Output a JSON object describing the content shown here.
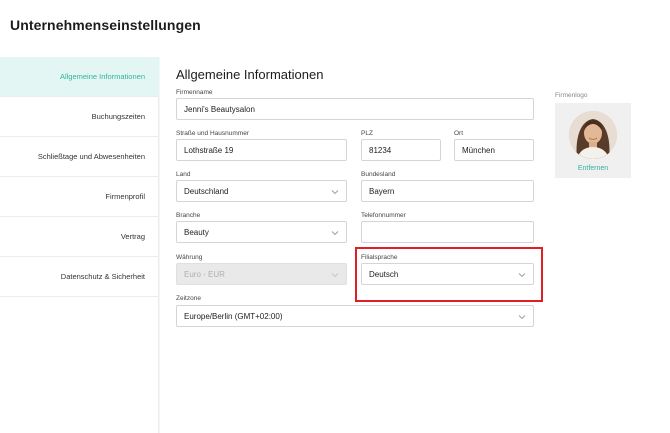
{
  "header": {
    "title": "Unternehmenseinstellungen"
  },
  "sidebar": {
    "items": [
      {
        "label": "Allgemeine Informationen",
        "active": true
      },
      {
        "label": "Buchungszeiten"
      },
      {
        "label": "Schließtage und Abwesenheiten"
      },
      {
        "label": "Firmenprofil"
      },
      {
        "label": "Vertrag"
      },
      {
        "label": "Datenschutz & Sicherheit"
      }
    ]
  },
  "main": {
    "title": "Allgemeine Informationen",
    "fields": {
      "company_name": {
        "label": "Firmenname",
        "value": "Jenni's Beautysalon"
      },
      "street": {
        "label": "Straße und Hausnummer",
        "value": "Lothstraße 19"
      },
      "zip": {
        "label": "PLZ",
        "value": "81234"
      },
      "city": {
        "label": "Ort",
        "value": "München"
      },
      "country": {
        "label": "Land",
        "value": "Deutschland"
      },
      "state": {
        "label": "Bundesland",
        "value": "Bayern"
      },
      "industry": {
        "label": "Branche",
        "value": "Beauty"
      },
      "phone": {
        "label": "Telefonnummer",
        "value": ""
      },
      "currency": {
        "label": "Währung",
        "value": "Euro - EUR"
      },
      "branch_language": {
        "label": "Filialsprache",
        "value": "Deutsch"
      },
      "timezone": {
        "label": "Zeitzone",
        "value": "Europe/Berlin (GMT+02:00)"
      }
    },
    "logo": {
      "label": "Firmenlogo",
      "remove_label": "Entfernen"
    }
  },
  "colors": {
    "accent": "#34b39c",
    "highlight": "#e01e26",
    "active_bg": "#e3f6f3"
  },
  "icons": {
    "dropdown": "chevron-down-icon"
  }
}
